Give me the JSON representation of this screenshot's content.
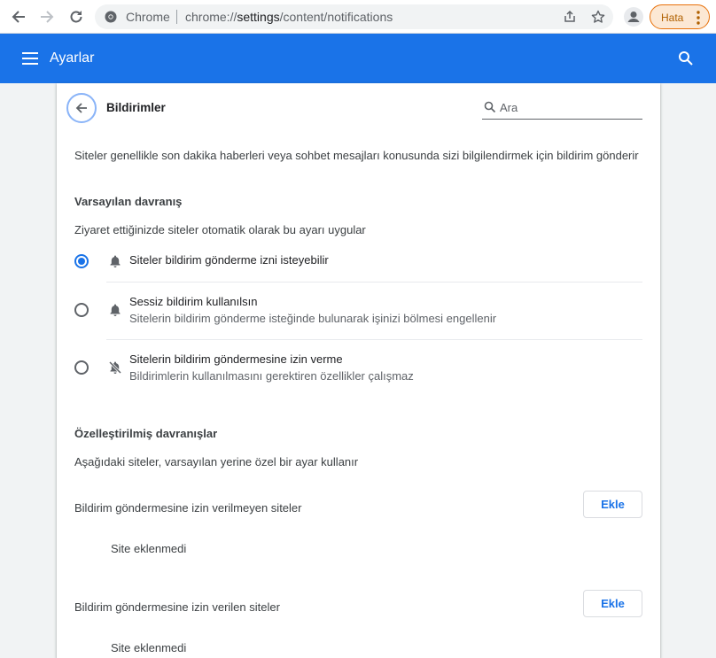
{
  "browser": {
    "omnibox_brand": "Chrome",
    "url_scheme": "chrome://",
    "url_host": "settings",
    "url_path": "/content/notifications",
    "error_chip_label": "Hata",
    "accent_color": "#1a73e8",
    "error_color": "#e8710a"
  },
  "header": {
    "title": "Ayarlar"
  },
  "page": {
    "title": "Bildirimler",
    "search_placeholder": "Ara",
    "description": "Siteler genellikle son dakika haberleri veya sohbet mesajları konusunda sizi bilgilendirmek için bildirim gönderir"
  },
  "default_behavior": {
    "title": "Varsayılan davranış",
    "description": "Ziyaret ettiğinizde siteler otomatik olarak bu ayarı uygular",
    "options": [
      {
        "label": "Siteler bildirim gönderme izni isteyebilir",
        "sublabel": "",
        "checked": true,
        "icon": "bell-icon"
      },
      {
        "label": "Sessiz bildirim kullanılsın",
        "sublabel": "Sitelerin bildirim gönderme isteğinde bulunarak işinizi bölmesi engellenir",
        "checked": false,
        "icon": "bell-icon"
      },
      {
        "label": "Sitelerin bildirim göndermesine izin verme",
        "sublabel": "Bildirimlerin kullanılmasını gerektiren özellikler çalışmaz",
        "checked": false,
        "icon": "bell-off-icon"
      }
    ]
  },
  "custom_behavior": {
    "title": "Özelleştirilmiş davranışlar",
    "description": "Aşağıdaki siteler, varsayılan yerine özel bir ayar kullanır",
    "lists": [
      {
        "label": "Bildirim göndermesine izin verilmeyen siteler",
        "add_button": "Ekle",
        "empty_text": "Site eklenmedi"
      },
      {
        "label": "Bildirim göndermesine izin verilen siteler",
        "add_button": "Ekle",
        "empty_text": "Site eklenmedi"
      }
    ]
  }
}
